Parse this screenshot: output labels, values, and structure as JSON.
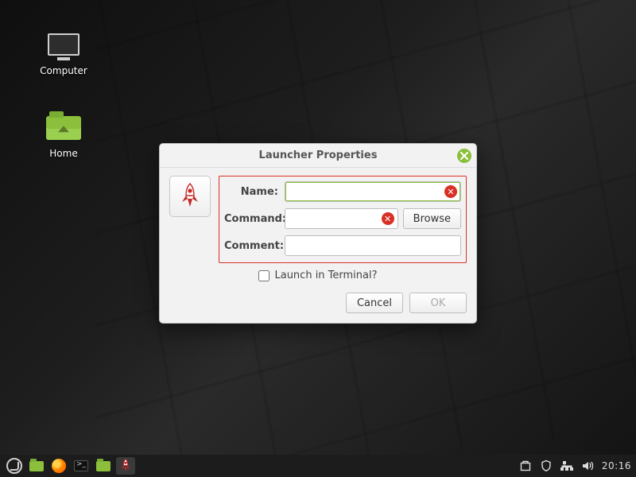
{
  "desktop": {
    "icons": [
      {
        "name": "Computer"
      },
      {
        "name": "Home"
      }
    ]
  },
  "dialog": {
    "title": "Launcher Properties",
    "fields": {
      "name_label": "Name:",
      "name_value": "",
      "command_label": "Command:",
      "command_value": "",
      "comment_label": "Comment:",
      "comment_value": "",
      "browse_label": "Browse",
      "terminal_label": "Launch in Terminal?",
      "terminal_checked": false
    },
    "buttons": {
      "cancel": "Cancel",
      "ok": "OK",
      "ok_enabled": false
    }
  },
  "panel": {
    "clock": "20:16"
  }
}
